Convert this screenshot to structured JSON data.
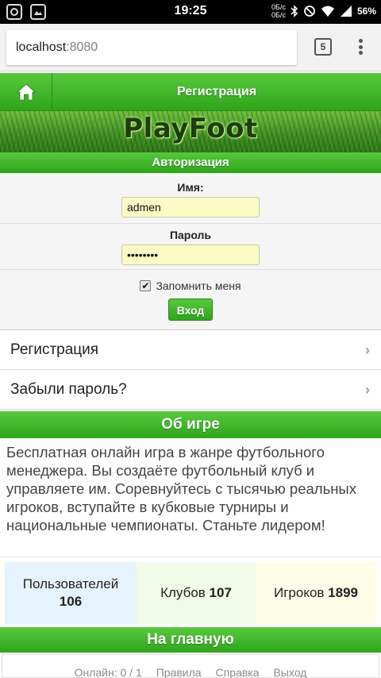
{
  "status_bar": {
    "time": "19:25",
    "data_up": "0Б/с",
    "data_down": "0Б/с",
    "battery": "56%"
  },
  "browser": {
    "url_host": "localhost",
    "url_port": ":8080",
    "tabs_count": "5"
  },
  "header": {
    "title": "Регистрация"
  },
  "banner": {
    "logo": "PlayFoot"
  },
  "auth": {
    "title": "Авторизация",
    "name_label": "Имя:",
    "name_value": "admen",
    "password_label": "Пароль",
    "password_value": "••••••••",
    "remember_label": "Запомнить меня",
    "remember_checked": true,
    "submit_label": "Вход"
  },
  "links": [
    {
      "label": "Регистрация"
    },
    {
      "label": "Забыли пароль?"
    }
  ],
  "about": {
    "title": "Об игре",
    "text": "Бесплатная онлайн игра в жанре футбольного менеджера. Вы создаёте футбольный клуб и управляете им. Соревнуйтесь с тысячью реальных игроков, вступайте в кубковые турниры и национальные чемпионаты. Станьте лидером!"
  },
  "stats": {
    "users_label": "Пользователей",
    "users_value": "106",
    "clubs_label": "Клубов",
    "clubs_value": "107",
    "players_label": "Игроков",
    "players_value": "1899"
  },
  "home_button": "На главную",
  "footer": {
    "online": "Онлайн: 0 / 1",
    "rules": "Правила",
    "help": "Справка",
    "logout": "Выход"
  },
  "colors": {
    "green_top": "#57c93d",
    "green_bottom": "#2fa51c",
    "input_bg": "#fbfbc6"
  }
}
